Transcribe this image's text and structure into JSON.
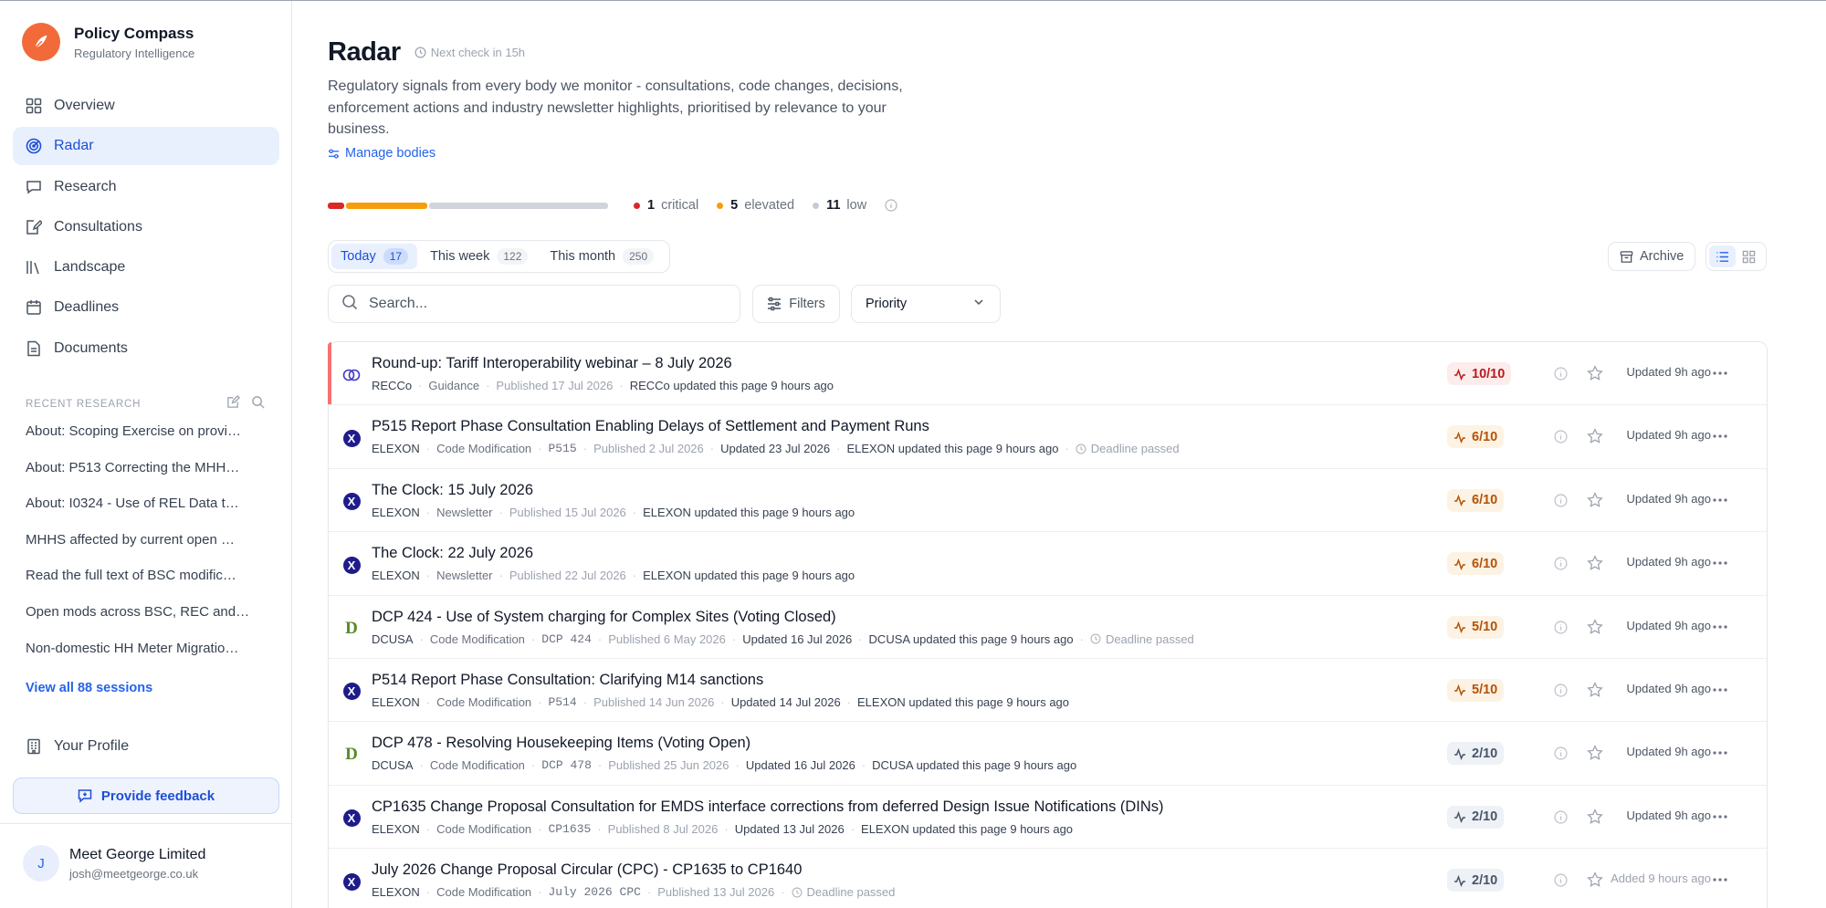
{
  "brand": {
    "name": "Policy Compass",
    "subtitle": "Regulatory Intelligence"
  },
  "nav": [
    {
      "label": "Overview",
      "icon": "grid-icon"
    },
    {
      "label": "Radar",
      "icon": "radar-icon",
      "active": true
    },
    {
      "label": "Research",
      "icon": "chat-icon"
    },
    {
      "label": "Consultations",
      "icon": "edit-document-icon"
    },
    {
      "label": "Landscape",
      "icon": "library-icon"
    },
    {
      "label": "Deadlines",
      "icon": "calendar-icon"
    },
    {
      "label": "Documents",
      "icon": "document-icon"
    }
  ],
  "recent": {
    "title": "RECENT RESEARCH",
    "items": [
      "About: Scoping Exercise on provi…",
      "About: P513 Correcting the MHH…",
      "About: I0324 - Use of REL Data t…",
      "MHHS affected by current open …",
      "Read the full text of BSC modific…",
      "Open mods across BSC, REC and…",
      "Non-domestic HH Meter Migratio…"
    ],
    "view_all": "View all 88 sessions"
  },
  "profile": {
    "label": "Your Profile"
  },
  "feedback": {
    "label": "Provide feedback"
  },
  "account": {
    "initial": "J",
    "name": "Meet George Limited",
    "email": "josh@meetgeorge.co.uk"
  },
  "header": {
    "title": "Radar",
    "next_check": "Next check in 15h",
    "description": "Regulatory signals from every body we monitor - consultations, code changes, decisions, enforcement actions and industry newsletter highlights, prioritised by relevance to your business.",
    "manage": "Manage bodies"
  },
  "summary": {
    "critical": {
      "count": "1",
      "label": "critical",
      "color": "#dc2626"
    },
    "elevated": {
      "count": "5",
      "label": "elevated",
      "color": "#f59e0b"
    },
    "low": {
      "count": "11",
      "label": "low",
      "color": "#d1d5db"
    }
  },
  "tabs": [
    {
      "label": "Today",
      "count": "17",
      "active": true
    },
    {
      "label": "This week",
      "count": "122"
    },
    {
      "label": "This month",
      "count": "250"
    }
  ],
  "toolbar": {
    "archive": "Archive",
    "search_placeholder": "Search...",
    "filters": "Filters",
    "priority": "Priority"
  },
  "colors": {
    "accent": "#2563eb",
    "brand": "#f26a3a",
    "score_high_bg": "#fdecec",
    "score_high_fg": "#b91c1c",
    "score_mid_bg": "#fdf3e4",
    "score_mid_fg": "#b45309",
    "score_low_bg": "#eef1f5",
    "score_low_fg": "#475569"
  },
  "signals": [
    {
      "title": "Round-up: Tariff Interoperability webinar – 8 July 2026",
      "source": "recco",
      "body": "RECCo",
      "type": "Guidance",
      "code": "",
      "published": "Published 17 Jul 2026",
      "updated": "",
      "note": "RECCo updated this page 9 hours ago",
      "deadline": "",
      "score": "10/10",
      "level": "high",
      "status": "Updated 9h ago",
      "critical": true
    },
    {
      "title": "P515 Report Phase Consultation Enabling Delays of Settlement and Payment Runs",
      "source": "elexon",
      "body": "ELEXON",
      "type": "Code Modification",
      "code": "P515",
      "published": "Published 2 Jul 2026",
      "updated": "Updated 23 Jul 2026",
      "note": "ELEXON updated this page 9 hours ago",
      "deadline": "Deadline passed",
      "score": "6/10",
      "level": "mid",
      "status": "Updated 9h ago"
    },
    {
      "title": "The Clock: 15 July 2026",
      "source": "elexon",
      "body": "ELEXON",
      "type": "Newsletter",
      "code": "",
      "published": "Published 15 Jul 2026",
      "updated": "",
      "note": "ELEXON updated this page 9 hours ago",
      "deadline": "",
      "score": "6/10",
      "level": "mid",
      "status": "Updated 9h ago"
    },
    {
      "title": "The Clock: 22 July 2026",
      "source": "elexon",
      "body": "ELEXON",
      "type": "Newsletter",
      "code": "",
      "published": "Published 22 Jul 2026",
      "updated": "",
      "note": "ELEXON updated this page 9 hours ago",
      "deadline": "",
      "score": "6/10",
      "level": "mid",
      "status": "Updated 9h ago"
    },
    {
      "title": "DCP 424 - Use of System charging for Complex Sites (Voting Closed)",
      "source": "dcusa",
      "body": "DCUSA",
      "type": "Code Modification",
      "code": "DCP 424",
      "published": "Published 6 May 2026",
      "updated": "Updated 16 Jul 2026",
      "note": "DCUSA updated this page 9 hours ago",
      "deadline": "Deadline passed",
      "score": "5/10",
      "level": "mid",
      "status": "Updated 9h ago"
    },
    {
      "title": "P514 Report Phase Consultation: Clarifying M14 sanctions",
      "source": "elexon",
      "body": "ELEXON",
      "type": "Code Modification",
      "code": "P514",
      "published": "Published 14 Jun 2026",
      "updated": "Updated 14 Jul 2026",
      "note": "ELEXON updated this page 9 hours ago",
      "deadline": "",
      "score": "5/10",
      "level": "mid",
      "status": "Updated 9h ago"
    },
    {
      "title": "DCP 478 - Resolving Housekeeping Items (Voting Open)",
      "source": "dcusa",
      "body": "DCUSA",
      "type": "Code Modification",
      "code": "DCP 478",
      "published": "Published 25 Jun 2026",
      "updated": "Updated 16 Jul 2026",
      "note": "DCUSA updated this page 9 hours ago",
      "deadline": "",
      "score": "2/10",
      "level": "low",
      "status": "Updated 9h ago"
    },
    {
      "title": "CP1635 Change Proposal Consultation for EMDS interface corrections from deferred Design Issue Notifications (DINs)",
      "source": "elexon",
      "body": "ELEXON",
      "type": "Code Modification",
      "code": "CP1635",
      "published": "Published 8 Jul 2026",
      "updated": "Updated 13 Jul 2026",
      "note": "ELEXON updated this page 9 hours ago",
      "deadline": "",
      "score": "2/10",
      "level": "low",
      "status": "Updated 9h ago"
    },
    {
      "title": "July 2026 Change Proposal Circular (CPC) - CP1635 to CP1640",
      "source": "elexon",
      "body": "ELEXON",
      "type": "Code Modification",
      "code": "July 2026 CPC",
      "published": "Published 13 Jul 2026",
      "updated": "",
      "note": "",
      "deadline": "Deadline passed",
      "score": "2/10",
      "level": "low",
      "status": "Added 9 hours ago",
      "status_muted": true
    }
  ]
}
